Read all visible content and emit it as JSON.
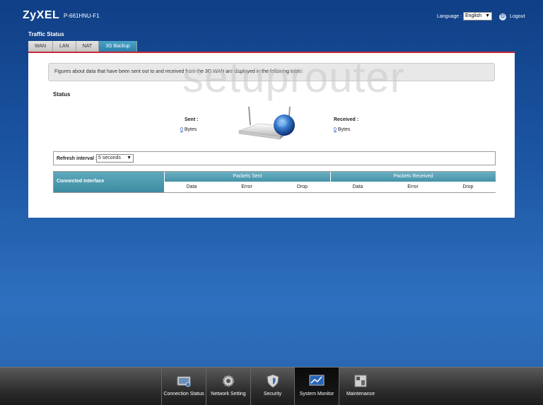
{
  "header": {
    "logo": "ZyXEL",
    "model": "P-661HNU-F1",
    "language_label": "Language :",
    "language_value": "English",
    "logout": "Logout"
  },
  "page": {
    "title": "Traffic Status",
    "tabs": [
      "WAN",
      "LAN",
      "NAT",
      "3G Backup"
    ],
    "active_tab": "3G Backup"
  },
  "info": {
    "text": "Figures about data that have been sent out to and received from the 3G WAN are displayed in the following table.",
    "watermark": "setuprouter"
  },
  "status": {
    "title": "Status",
    "sent_label": "Sent :",
    "sent_value": "0",
    "sent_unit": "Bytes",
    "received_label": "Received :",
    "received_value": "0",
    "received_unit": "Bytes"
  },
  "refresh": {
    "label": "Refresh interval :",
    "value": "5 seconds"
  },
  "table": {
    "iface_header": "Connected Interface",
    "group_sent": "Packets Sent",
    "group_received": "Packets Received",
    "sub_headers": [
      "Data",
      "Error",
      "Drop",
      "Data",
      "Error",
      "Drop"
    ]
  },
  "bottom_nav": {
    "items": [
      "Connection Status",
      "Network Setting",
      "Security",
      "System Monitor",
      "Maintenance"
    ],
    "active": "System Monitor"
  }
}
